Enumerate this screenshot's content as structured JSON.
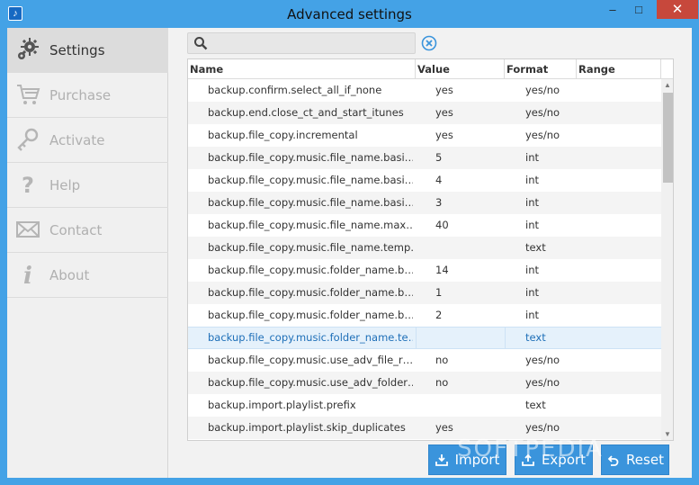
{
  "window": {
    "title": "Advanced settings",
    "minimize": "–",
    "maximize": "□",
    "close": "✕"
  },
  "sidebar": {
    "items": [
      {
        "label": "Settings",
        "icon": "gear-icon",
        "active": true
      },
      {
        "label": "Purchase",
        "icon": "cart-icon",
        "active": false
      },
      {
        "label": "Activate",
        "icon": "key-icon",
        "active": false
      },
      {
        "label": "Help",
        "icon": "question-icon",
        "active": false
      },
      {
        "label": "Contact",
        "icon": "envelope-icon",
        "active": false
      },
      {
        "label": "About",
        "icon": "info-icon",
        "active": false
      }
    ]
  },
  "search": {
    "value": "",
    "placeholder": ""
  },
  "table": {
    "columns": [
      "Name",
      "Value",
      "Format",
      "Range"
    ],
    "selected_index": 11,
    "rows": [
      {
        "name": "backup.confirm.select_all_if_none",
        "value": "yes",
        "format": "yes/no"
      },
      {
        "name": "backup.end.close_ct_and_start_itunes",
        "value": "yes",
        "format": "yes/no"
      },
      {
        "name": "backup.file_copy.incremental",
        "value": "yes",
        "format": "yes/no"
      },
      {
        "name": "backup.file_copy.music.file_name.basi…",
        "value": "5",
        "format": "int"
      },
      {
        "name": "backup.file_copy.music.file_name.basi…",
        "value": "4",
        "format": "int"
      },
      {
        "name": "backup.file_copy.music.file_name.basi…",
        "value": "3",
        "format": "int"
      },
      {
        "name": "backup.file_copy.music.file_name.max…",
        "value": "40",
        "format": "int"
      },
      {
        "name": "backup.file_copy.music.file_name.temp…",
        "value": "",
        "format": "text"
      },
      {
        "name": "backup.file_copy.music.folder_name.b…",
        "value": "14",
        "format": "int"
      },
      {
        "name": "backup.file_copy.music.folder_name.b…",
        "value": "1",
        "format": "int"
      },
      {
        "name": "backup.file_copy.music.folder_name.b…",
        "value": "2",
        "format": "int"
      },
      {
        "name": "backup.file_copy.music.folder_name.te…",
        "value": "",
        "format": "text"
      },
      {
        "name": "backup.file_copy.music.use_adv_file_r…",
        "value": "no",
        "format": "yes/no"
      },
      {
        "name": "backup.file_copy.music.use_adv_folder…",
        "value": "no",
        "format": "yes/no"
      },
      {
        "name": "backup.import.playlist.prefix",
        "value": "",
        "format": "text"
      },
      {
        "name": "backup.import.playlist.skip_duplicates",
        "value": "yes",
        "format": "yes/no"
      }
    ]
  },
  "buttons": {
    "import": "Import",
    "export": "Export",
    "reset": "Reset"
  },
  "watermark": "SOFTPEDIA",
  "colors": {
    "accent": "#3a94dc",
    "frame": "#44a2e6",
    "close": "#c7483c",
    "selected_row": "#e5f1fb",
    "selected_text": "#1e6fb8"
  }
}
